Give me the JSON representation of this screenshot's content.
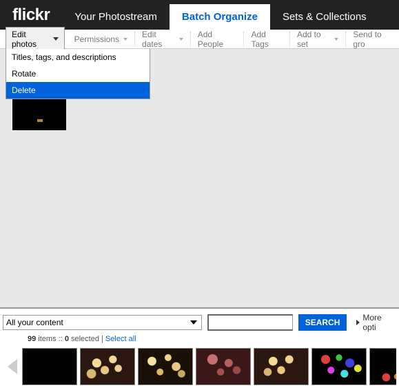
{
  "logo": "flickr",
  "tabs": [
    {
      "label": "Your Photostream"
    },
    {
      "label": "Batch Organize"
    },
    {
      "label": "Sets & Collections"
    }
  ],
  "toolbar": {
    "edit_photos": "Edit photos",
    "permissions": "Permissions",
    "edit_dates": "Edit dates",
    "add_people": "Add People",
    "add_tags": "Add Tags",
    "add_to_set": "Add to set",
    "send_to_group": "Send to gro"
  },
  "dropdown": {
    "titles": "Titles, tags, and descriptions",
    "rotate": "Rotate",
    "delete": "Delete"
  },
  "filter": {
    "content_select": "All your content",
    "search_btn": "SEARCH",
    "more_options": "More opti"
  },
  "status": {
    "count": "99",
    "items_label": " items :: ",
    "selected_count": "0",
    "selected_label": " selected",
    "separator": " | ",
    "select_all": "Select all"
  }
}
